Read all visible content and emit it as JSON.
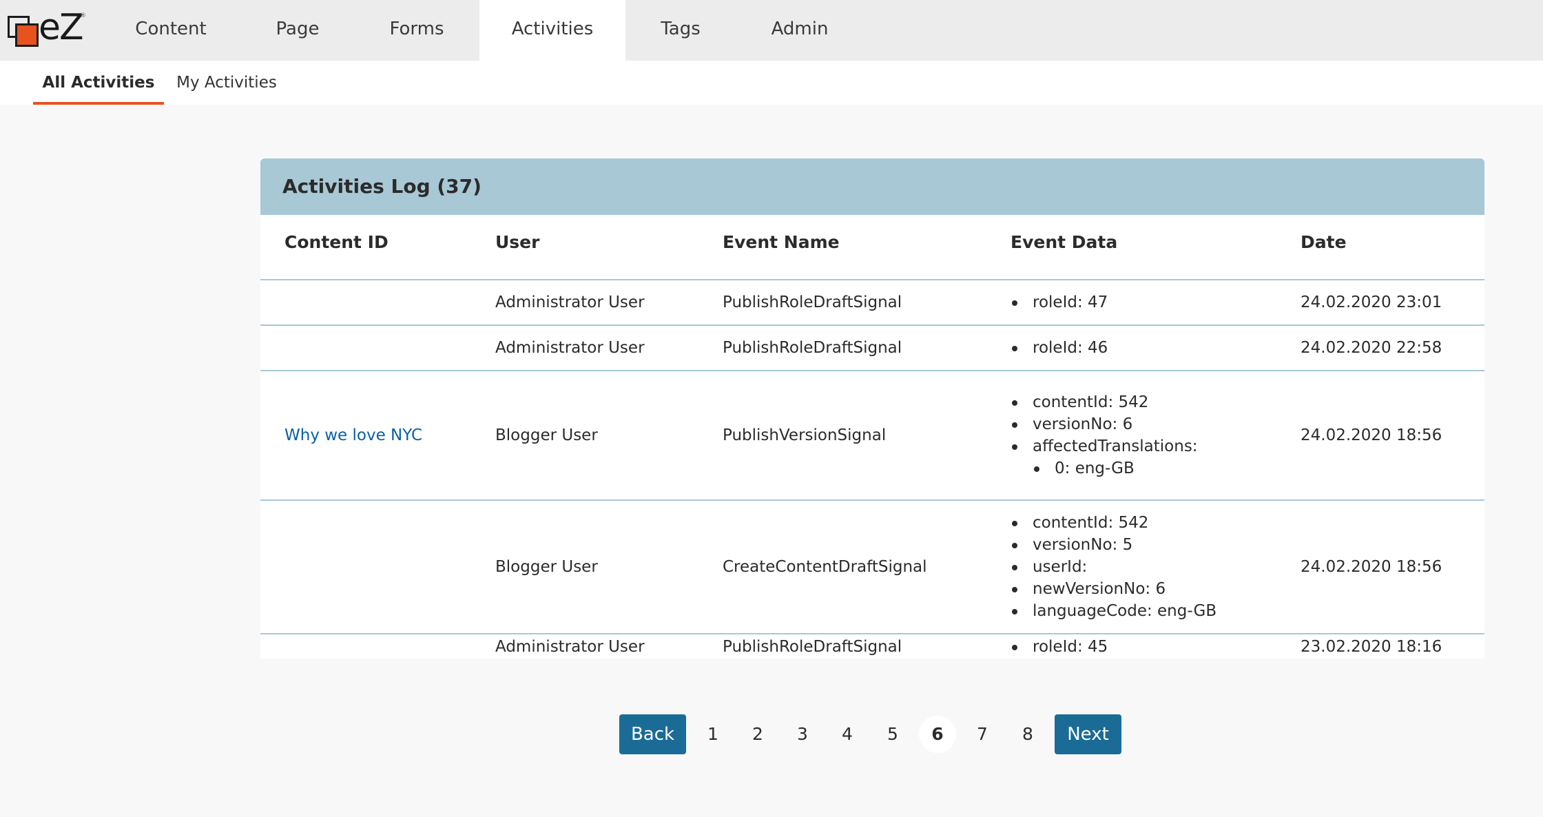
{
  "app": {
    "logo_text": "eZ",
    "logo_mark": "®"
  },
  "nav": {
    "items": [
      "Content",
      "Page",
      "Forms",
      "Activities",
      "Tags",
      "Admin"
    ],
    "active": "Activities"
  },
  "subnav": {
    "tabs": [
      "All Activities",
      "My Activities"
    ],
    "active": "All Activities"
  },
  "log": {
    "title": "Activities Log (37)",
    "columns": [
      "Content ID",
      "User",
      "Event Name",
      "Event Data",
      "Date"
    ],
    "rows": [
      {
        "content": "",
        "user": "Administrator User",
        "event": "PublishRoleDraftSignal",
        "data": [
          "roleId: 47"
        ],
        "date": "24.02.2020 23:01"
      },
      {
        "content": "",
        "user": "Administrator User",
        "event": "PublishRoleDraftSignal",
        "data": [
          "roleId: 46"
        ],
        "date": "24.02.2020 22:58"
      },
      {
        "content": "Why we love NYC",
        "user": "Blogger User",
        "event": "PublishVersionSignal",
        "data": [
          "contentId: 542",
          "versionNo: 6",
          "affectedTranslations:",
          "0: eng-GB"
        ],
        "date": "24.02.2020 18:56"
      },
      {
        "content": "",
        "user": "Blogger User",
        "event": "CreateContentDraftSignal",
        "data": [
          "contentId: 542",
          "versionNo: 5",
          "userId:",
          "newVersionNo: 6",
          "languageCode: eng-GB"
        ],
        "date": "24.02.2020 18:56"
      },
      {
        "content": "",
        "user": "Administrator User",
        "event": "PublishRoleDraftSignal",
        "data": [
          "roleId: 45"
        ],
        "date": "23.02.2020 18:16"
      }
    ]
  },
  "pagination": {
    "back_label": "Back",
    "next_label": "Next",
    "pages": [
      "1",
      "2",
      "3",
      "4",
      "5",
      "6",
      "7",
      "8"
    ],
    "current": "6"
  },
  "colors": {
    "accent": "#e6531f",
    "header_bg": "#a8c8d6",
    "button_bg": "#1a6c96",
    "link": "#0b5fa5"
  }
}
